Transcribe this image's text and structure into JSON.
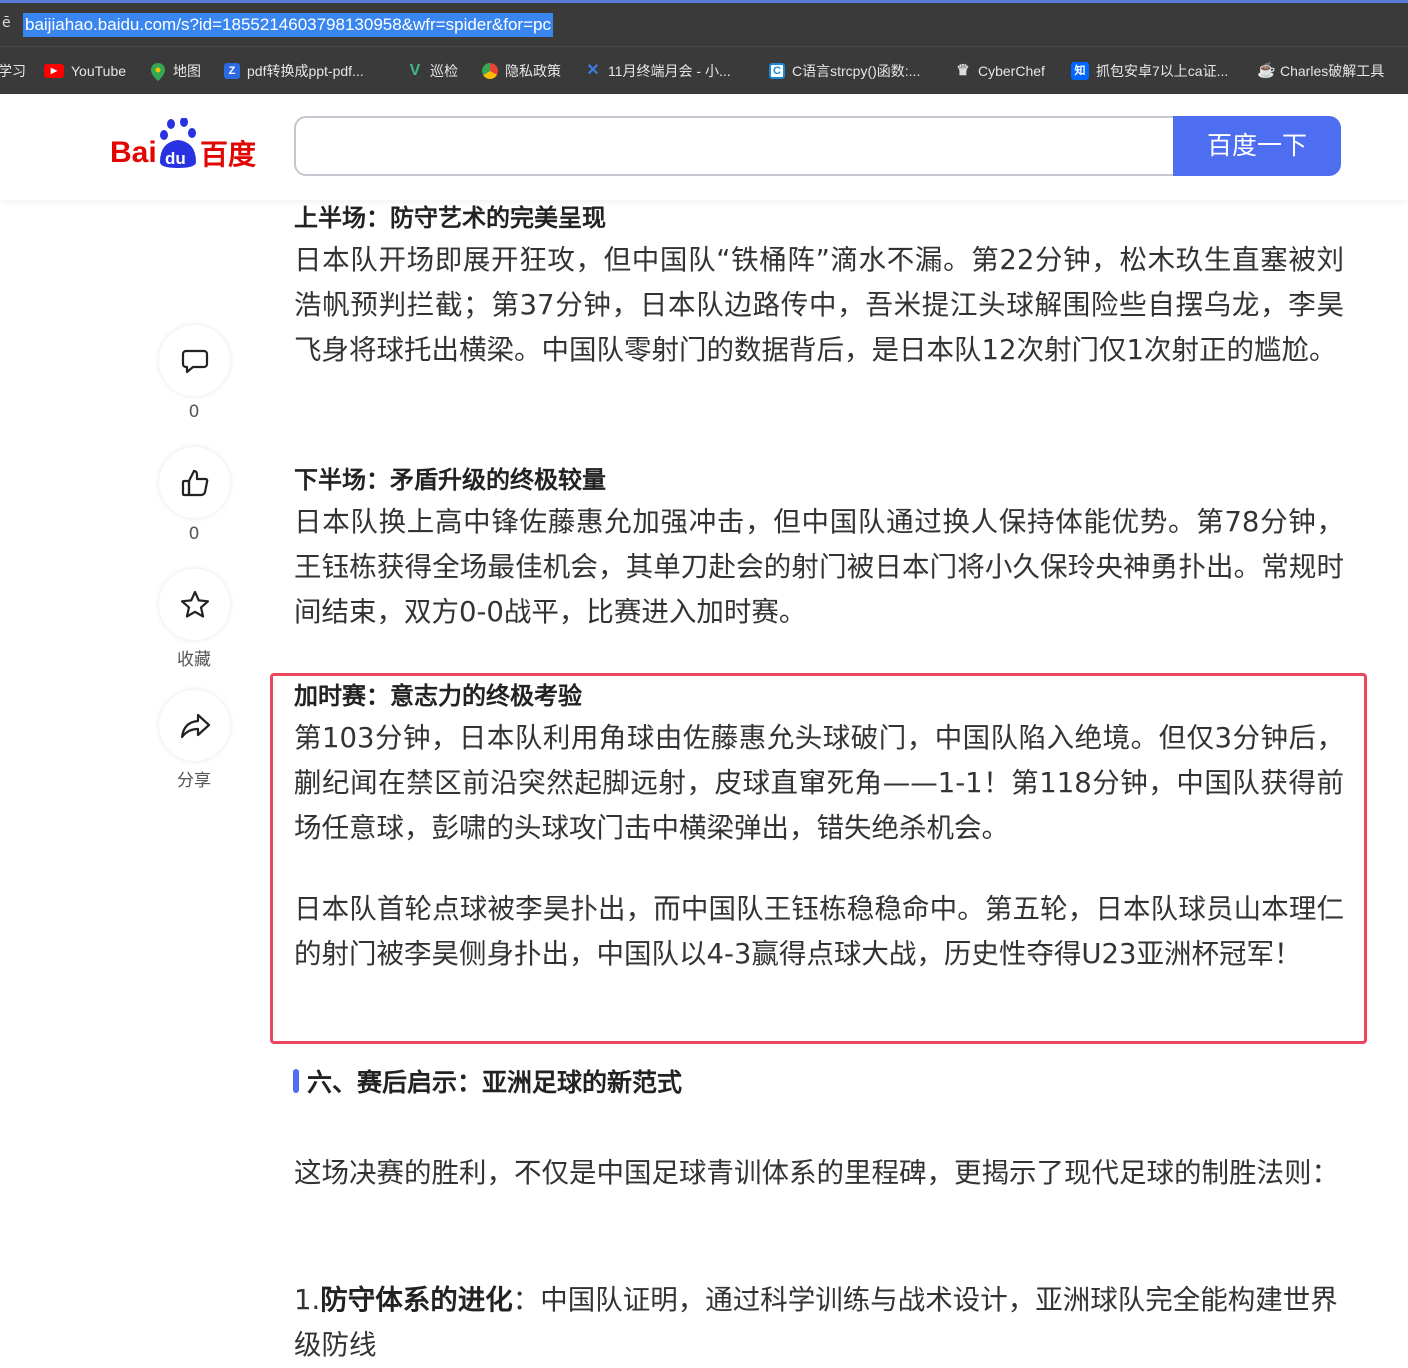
{
  "browser": {
    "url": "baijiahao.baidu.com/s?id=1855214603798130958&wfr=spider&for=pc",
    "bookmarks": [
      {
        "label": "学习",
        "icon": "bookmark-icon",
        "color": "#888888"
      },
      {
        "label": "YouTube",
        "icon": "youtube-icon",
        "color": "#ff0000"
      },
      {
        "label": "地图",
        "icon": "maps-pin-icon",
        "color": "#34a853"
      },
      {
        "label": "pdf转换成ppt-pdf...",
        "icon": "z-icon",
        "color": "#2b6ae0"
      },
      {
        "label": "巡检",
        "icon": "vue-icon",
        "color": "#41b883"
      },
      {
        "label": "隐私政策",
        "icon": "chrome-icon",
        "color": "#fbbc05"
      },
      {
        "label": "11月终端月会 - 小...",
        "icon": "x-icon",
        "color": "#2a6ad4"
      },
      {
        "label": "C语言strcpy()函数:...",
        "icon": "c-icon",
        "color": "#1a8ad4"
      },
      {
        "label": "CyberChef",
        "icon": "chef-hat-icon",
        "color": "#dddddd"
      },
      {
        "label": "抓包安卓7以上ca证...",
        "icon": "zhihu-icon",
        "color": "#0066ff"
      },
      {
        "label": "Charles破解工具",
        "icon": "charles-icon",
        "color": "#dddddd"
      }
    ]
  },
  "header": {
    "logo_text_left": "Bai",
    "logo_text_mid": "du",
    "logo_text_right": "百度",
    "search_value": "",
    "search_button": "百度一下",
    "accent_color": "#4e6ef2"
  },
  "rail": {
    "comment_count": "0",
    "like_count": "0",
    "collect_label": "收藏",
    "share_label": "分享"
  },
  "article": {
    "first_half_title": "上半场：防守艺术的完美呈现",
    "first_half_text": "日本队开场即展开狂攻，但中国队“铁桶阵”滴水不漏。第22分钟，松木玖生直塞被刘浩帆预判拦截；第37分钟，日本队边路传中，吾米提江头球解围险些自摆乌龙，李昊飞身将球托出横梁。中国队零射门的数据背后，是日本队12次射门仅1次射正的尴尬。",
    "second_half_title": "下半场：矛盾升级的终极较量",
    "second_half_text": "日本队换上高中锋佐藤惠允加强冲击，但中国队通过换人保持体能优势。第78分钟，王钰栋获得全场最佳机会，其单刀赴会的射门被日本门将小久保玲央神勇扑出。常规时间结束，双方0-0战平，比赛进入加时赛。",
    "extra_time_title": "加时赛：意志力的终极考验",
    "extra_time_text": "第103分钟，日本队利用角球由佐藤惠允头球破门，中国队陷入绝境。但仅3分钟后，蒯纪闻在禁区前沿突然起脚远射，皮球直窜死角——1-1！第118分钟，中国队获得前场任意球，彭啸的头球攻门击中横梁弹出，错失绝杀机会。",
    "penalty_text": "日本队首轮点球被李昊扑出，而中国队王钰栋稳稳命中。第五轮，日本队球员山本理仁的射门被李昊侧身扑出，中国队以4-3赢得点球大战，历史性夺得U23亚洲杯冠军！",
    "section6_title": "六、赛后启示：亚洲足球的新范式",
    "section6_intro": "这场决赛的胜利，不仅是中国足球青训体系的里程碑，更揭示了现代足球的制胜法则：",
    "list1_num": "1.",
    "list1_bold": "防守体系的进化",
    "list1_text": "：中国队证明，通过科学训练与战术设计，亚洲球队完全能构建世界级防线",
    "highlight_color": "#e9475c"
  }
}
